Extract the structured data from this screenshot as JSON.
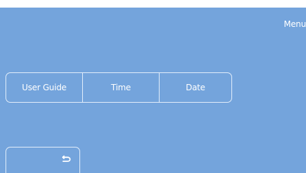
{
  "screen": {
    "title": "Menu"
  },
  "tabs": [
    {
      "label": "User Guide"
    },
    {
      "label": "Time"
    },
    {
      "label": "Date"
    }
  ],
  "back_button": {
    "icon": "return-arrow-icon"
  },
  "colors": {
    "background": "#74a4dc",
    "border": "#e3eefb",
    "text": "#ffffff"
  }
}
